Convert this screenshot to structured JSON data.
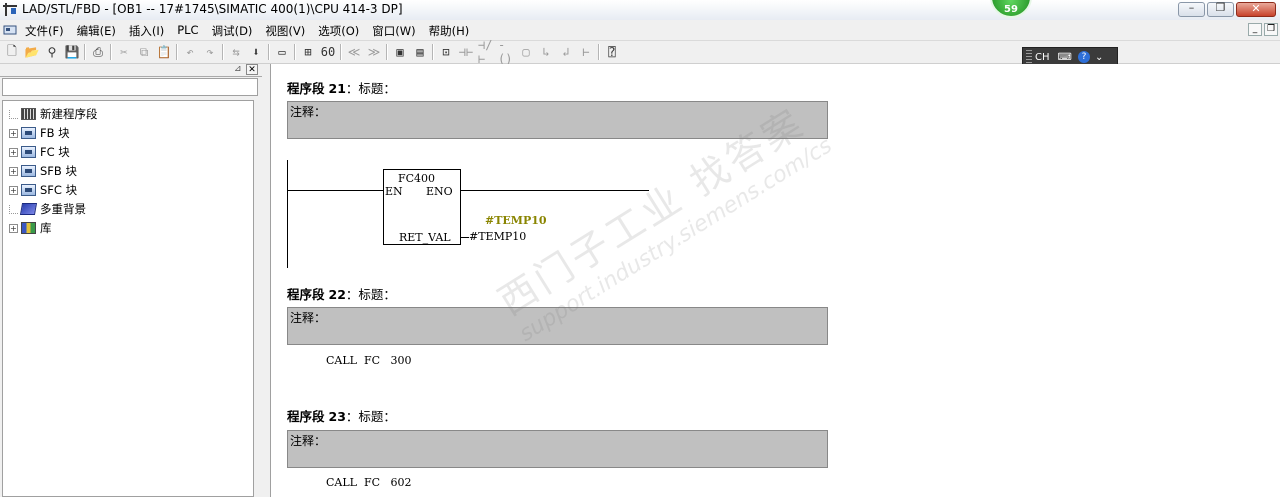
{
  "window": {
    "title": "LAD/STL/FBD  - [OB1 -- 17#1745\\SIMATIC 400(1)\\CPU 414-3 DP]",
    "badge": "59",
    "app_icon": "lad-editor-icon"
  },
  "menu": {
    "items": [
      "文件(F)",
      "编辑(E)",
      "插入(I)",
      "PLC",
      "调试(D)",
      "视图(V)",
      "选项(O)",
      "窗口(W)",
      "帮助(H)"
    ]
  },
  "ime": {
    "label": "CH"
  },
  "tree": {
    "items": [
      {
        "label": "新建程序段",
        "icon": "network-icon",
        "expandable": false
      },
      {
        "label": "FB 块",
        "icon": "block-folder-icon",
        "expandable": true
      },
      {
        "label": "FC 块",
        "icon": "block-folder-icon",
        "expandable": true
      },
      {
        "label": "SFB 块",
        "icon": "block-folder-icon",
        "expandable": true
      },
      {
        "label": "SFC 块",
        "icon": "block-folder-icon",
        "expandable": true
      },
      {
        "label": "多重背景",
        "icon": "multi-instance-icon",
        "expandable": false
      },
      {
        "label": "库",
        "icon": "library-icon",
        "expandable": true
      }
    ]
  },
  "networks": [
    {
      "prefix": "程序段",
      "number": "21",
      "sep": "：",
      "title_label": "标题：",
      "comment_label": "注释：",
      "ladder": {
        "block_name": "FC400",
        "en": "EN",
        "eno": "ENO",
        "ret_val": "RET_VAL",
        "ret_operand": "#TEMP10",
        "annotation": "#TEMP10"
      }
    },
    {
      "prefix": "程序段",
      "number": "22",
      "sep": "：",
      "title_label": "标题：",
      "comment_label": "注释：",
      "stl": "CALL  FC   300"
    },
    {
      "prefix": "程序段",
      "number": "23",
      "sep": "：",
      "title_label": "标题：",
      "comment_label": "注释：",
      "stl": "CALL  FC   602"
    }
  ],
  "watermark": {
    "line1": "西门子工业  找答案",
    "line2": "support.industry.siemens.com/cs"
  }
}
